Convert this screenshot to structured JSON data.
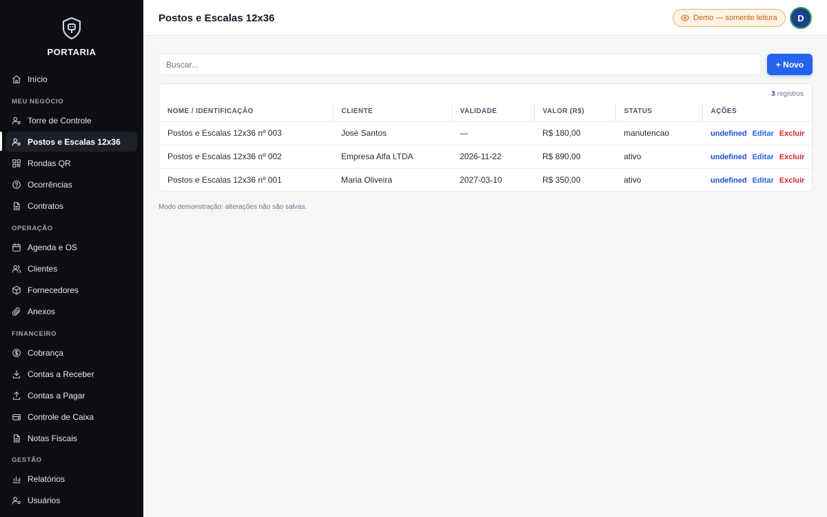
{
  "brand": {
    "name": "PORTARIA"
  },
  "sidebar": {
    "items": [
      {
        "label": "Início",
        "icon": "home-icon"
      }
    ],
    "sections": [
      {
        "title": "MEU NEGÓCIO",
        "items": [
          {
            "label": "Torre de Controle",
            "icon": "user-gear-icon"
          },
          {
            "label": "Postos e Escalas 12x36",
            "icon": "user-gear-icon",
            "active": true
          },
          {
            "label": "Rondas QR",
            "icon": "qr-icon"
          },
          {
            "label": "Ocorrências",
            "icon": "help-circle-icon"
          },
          {
            "label": "Contratos",
            "icon": "document-icon"
          }
        ]
      },
      {
        "title": "OPERAÇÃO",
        "items": [
          {
            "label": "Agenda e OS",
            "icon": "calendar-icon"
          },
          {
            "label": "Clientes",
            "icon": "users-icon"
          },
          {
            "label": "Fornecedores",
            "icon": "box-icon"
          },
          {
            "label": "Anexos",
            "icon": "paperclip-icon"
          }
        ]
      },
      {
        "title": "FINANCEIRO",
        "items": [
          {
            "label": "Cobrança",
            "icon": "dollar-circle-icon"
          },
          {
            "label": "Contas a Receber",
            "icon": "download-icon"
          },
          {
            "label": "Contas a Pagar",
            "icon": "upload-icon"
          },
          {
            "label": "Controle de Caixa",
            "icon": "cash-register-icon"
          },
          {
            "label": "Notas Fiscais",
            "icon": "document-icon"
          }
        ]
      },
      {
        "title": "GESTÃO",
        "items": [
          {
            "label": "Relatórios",
            "icon": "bar-chart-icon"
          },
          {
            "label": "Usuários",
            "icon": "user-gear-icon"
          }
        ]
      }
    ]
  },
  "header": {
    "title": "Postos e Escalas 12x36",
    "demo_badge": "Demo — somente leitura",
    "avatar_initial": "D"
  },
  "search": {
    "placeholder": "Buscar..."
  },
  "toolbar": {
    "new_label": "+ Novo"
  },
  "table": {
    "count": "3",
    "count_label": "registros",
    "columns": [
      "NOME / IDENTIFICAÇÃO",
      "CLIENTE",
      "VALIDADE",
      "VALOR (R$)",
      "STATUS",
      "AÇÕES"
    ],
    "rows": [
      {
        "name": "Postos e Escalas 12x36 nº 003",
        "client": "José Santos",
        "validity": "—",
        "value": "R$ 180,00",
        "status": "manutencao"
      },
      {
        "name": "Postos e Escalas 12x36 nº 002",
        "client": "Empresa Alfa LTDA",
        "validity": "2026-11-22",
        "value": "R$ 890,00",
        "status": "ativo"
      },
      {
        "name": "Postos e Escalas 12x36 nº 001",
        "client": "Maria Oliveira",
        "validity": "2027-03-10",
        "value": "R$ 350,00",
        "status": "ativo"
      }
    ],
    "actions": {
      "view": "undefined",
      "edit": "Editar",
      "delete": "Excluir"
    }
  },
  "footer_note": "Modo demonstração: alterações não são salvas.",
  "colors": {
    "sidebar_bg": "#0d0e14",
    "accent": "#2563eb",
    "danger": "#dc2626",
    "badge": "#c2640e"
  }
}
